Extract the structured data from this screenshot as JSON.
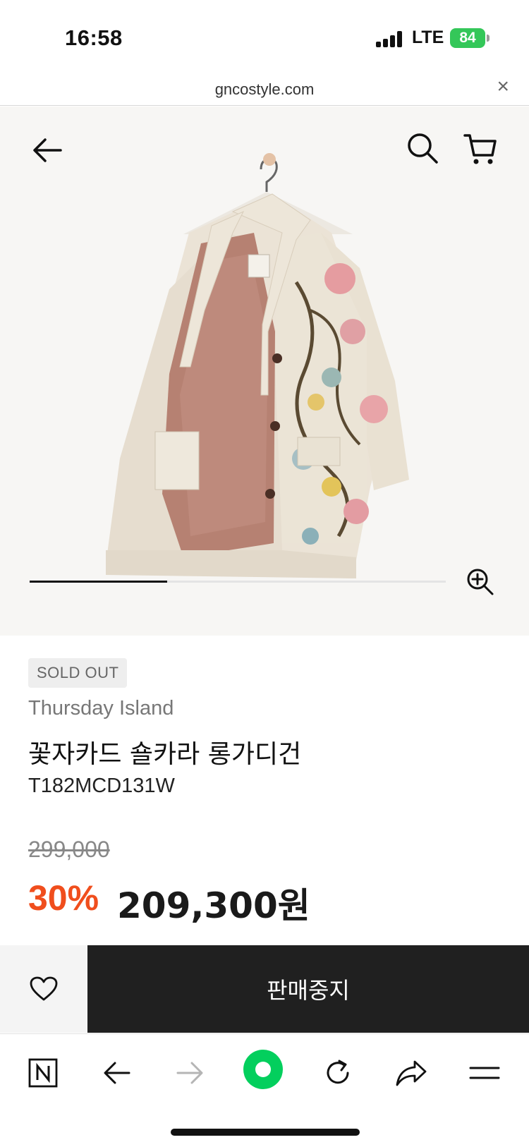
{
  "status": {
    "time": "16:58",
    "network": "LTE",
    "battery": "84"
  },
  "browser": {
    "url": "gncostyle.com",
    "close_icon": "close-icon"
  },
  "header": {
    "back_icon": "back-arrow-icon",
    "search_icon": "search-icon",
    "cart_icon": "cart-icon"
  },
  "gallery": {
    "progress_fraction": 0.33,
    "zoom_icon": "zoom-in-icon"
  },
  "product": {
    "badge": "SOLD OUT",
    "brand": "Thursday Island",
    "name": "꽃자카드 숄카라 롱가디건",
    "code": "T182MCD131W",
    "price_original": "299,000",
    "discount": "30%",
    "price_final": "209,300원"
  },
  "actions": {
    "wish_icon": "heart-icon",
    "stop_label": "판매중지"
  },
  "toolbar": {
    "items": [
      "naver-n-icon",
      "back-icon",
      "forward-icon",
      "green-dot-icon",
      "reload-icon",
      "share-icon",
      "menu-icon"
    ]
  },
  "colors": {
    "discount": "#f04e1d",
    "action_bar": "#202020",
    "green": "#03cf5d",
    "battery": "#34c759"
  }
}
